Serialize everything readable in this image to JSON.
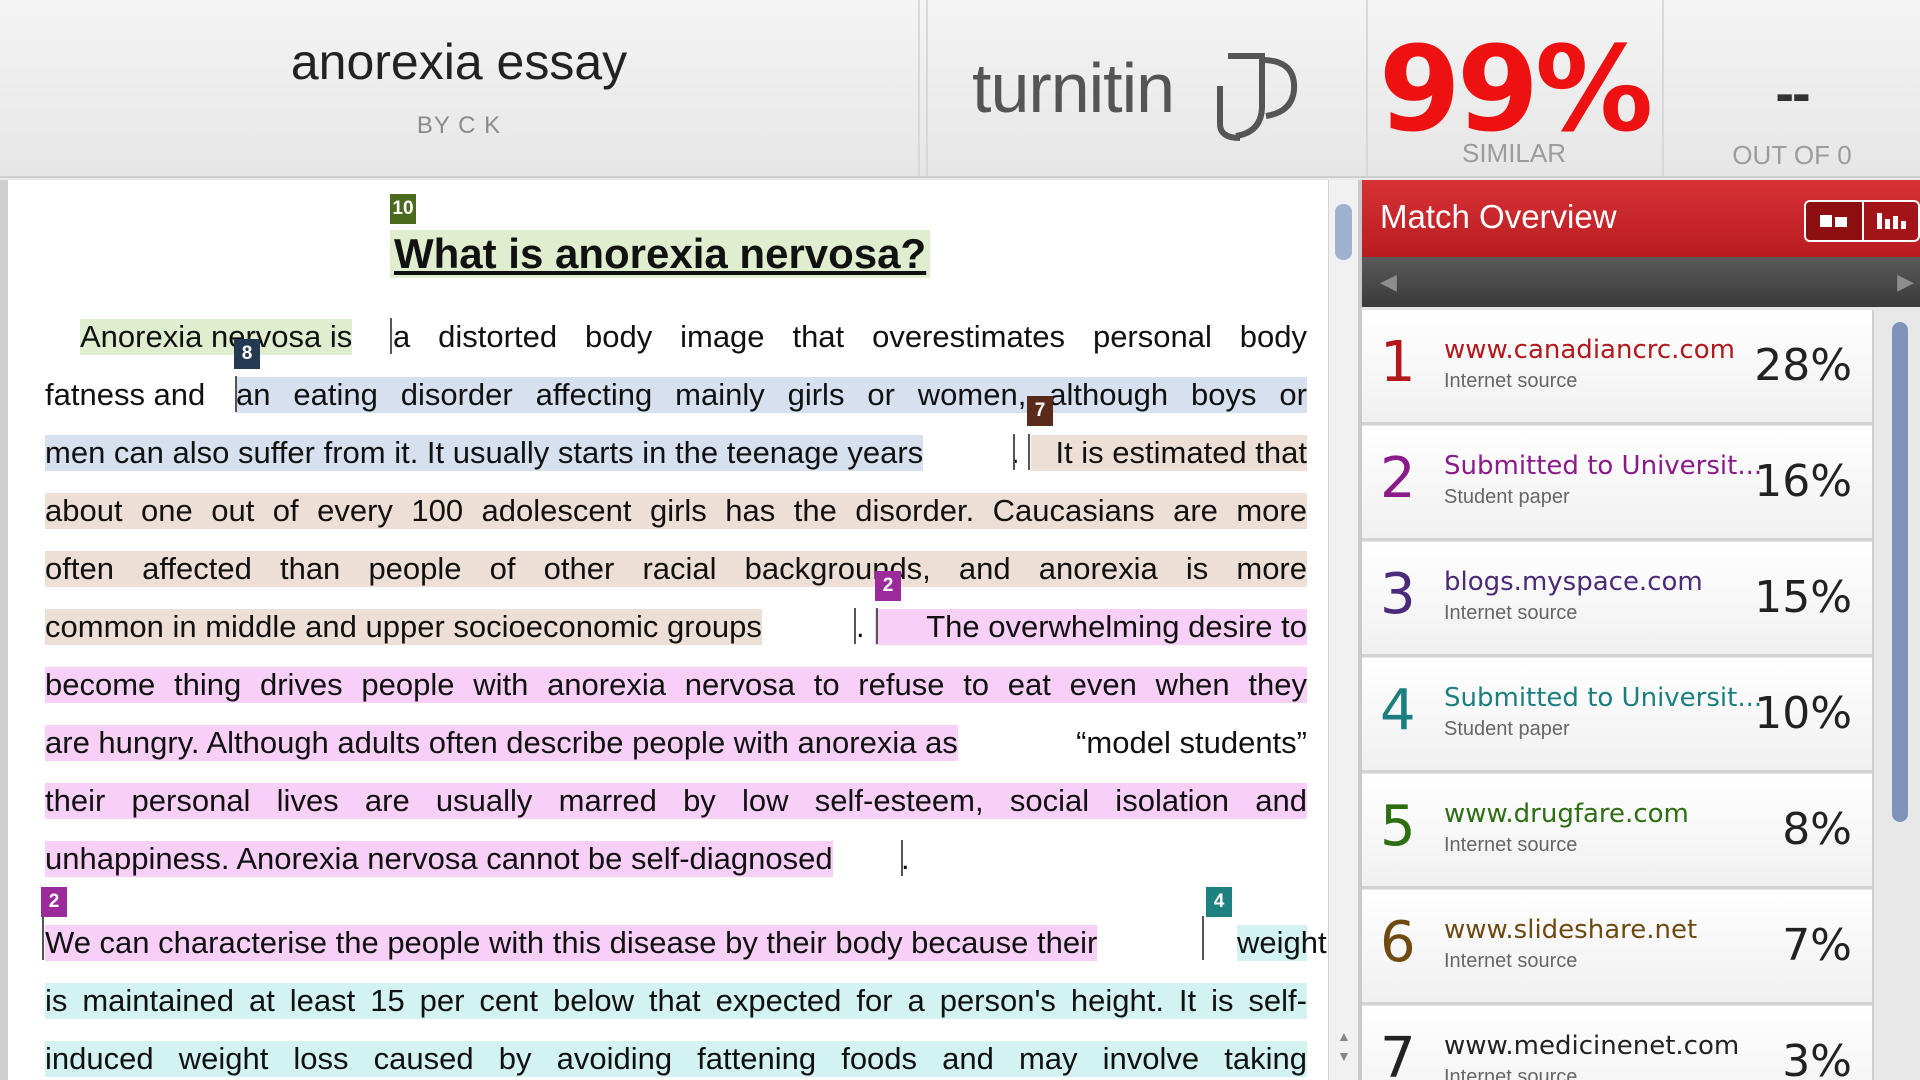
{
  "header": {
    "doc_title": "anorexia essay",
    "doc_author": "BY C K",
    "brand": "turnitin",
    "similarity_value": "99%",
    "similarity_label": "SIMILAR",
    "out_of_value": "--",
    "out_of_label": "OUT OF 0"
  },
  "document": {
    "heading_badge": "10",
    "heading": "What is anorexia nervosa?",
    "badges": {
      "b8": "8",
      "b7": "7",
      "b2a": "2",
      "b2b": "2",
      "b4": "4"
    },
    "p1": {
      "l1_a": "Anorexia nervosa is",
      "l1_b": " a distorted body image that overestimates personal body",
      "l2_a": "fatness and ",
      "l2_b": "an eating disorder affecting mainly girls or women, although boys or",
      "l3_a": "men can also suffer from it. It usually starts in the teenage years",
      "l3_b": ". ",
      "l3_c": "It is estimated that",
      "l4": "about one out of every 100 adolescent girls has the disorder. Caucasians are more",
      "l5": "often affected than people of other racial backgrounds, and anorexia is more",
      "l6_a": "common in middle and upper socioeconomic groups",
      "l6_b": ". ",
      "l6_c": "The overwhelming desire to",
      "l7": "become thing drives people with anorexia nervosa to refuse to eat even when they",
      "l8_a": "are hungry. Although adults often describe people with anorexia as",
      "l8_b": " “model students”",
      "l9": "their personal lives are usually marred by low self-esteem, social isolation and",
      "l10_a": "unhappiness. Anorexia nervosa cannot be self-diagnosed",
      "l10_b": "."
    },
    "p2": {
      "l1_a": "We can characterise the people with this disease by their body because their",
      "l1_b": " weight",
      "l2": "is maintained at least 15 per cent below that expected for a person's height. It is self-",
      "l3": "induced weight loss caused by avoiding fattening foods and may involve taking"
    }
  },
  "match_overview": {
    "title": "Match Overview",
    "toggle_left_icon": "single-view-icon",
    "toggle_right_icon": "bar-view-icon",
    "prev_icon": "◀",
    "next_icon": "▶",
    "matches": [
      {
        "rank": "1",
        "source": "www.canadiancrc.com",
        "type": "Internet source",
        "percent": "28%",
        "color": "#b3181c"
      },
      {
        "rank": "2",
        "source": "Submitted to Universit...",
        "type": "Student paper",
        "percent": "16%",
        "color": "#8b1a8b"
      },
      {
        "rank": "3",
        "source": "blogs.myspace.com",
        "type": "Internet source",
        "percent": "15%",
        "color": "#4b2a7a"
      },
      {
        "rank": "4",
        "source": "Submitted to Universit...",
        "type": "Student paper",
        "percent": "10%",
        "color": "#1c7f7f"
      },
      {
        "rank": "5",
        "source": "www.drugfare.com",
        "type": "Internet source",
        "percent": "8%",
        "color": "#2d6e12"
      },
      {
        "rank": "6",
        "source": "www.slideshare.net",
        "type": "Internet source",
        "percent": "7%",
        "color": "#6e4a12"
      },
      {
        "rank": "7",
        "source": "www.medicinenet.com",
        "type": "Internet source",
        "percent": "3%",
        "color": "#222222"
      }
    ]
  }
}
